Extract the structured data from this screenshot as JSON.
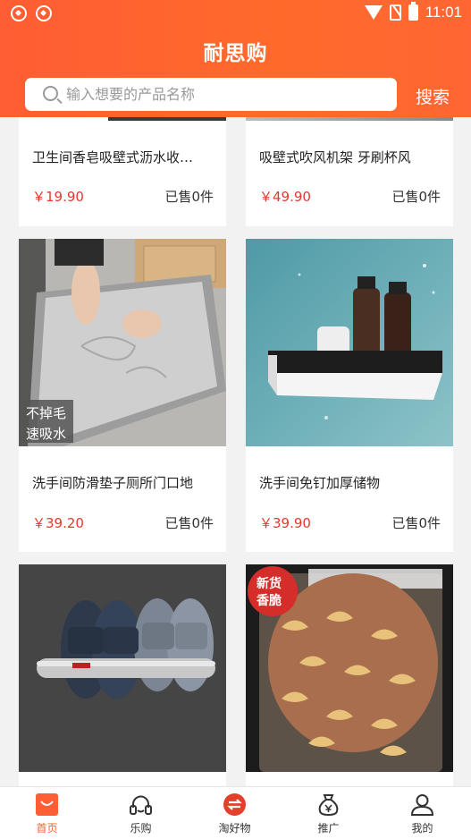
{
  "status_bar": {
    "time": "11:01"
  },
  "header": {
    "title": "耐思购"
  },
  "search": {
    "placeholder": "输入想要的产品名称",
    "button_label": "搜索"
  },
  "products": [
    {
      "name": "卫生间香皂吸壁式沥水收…",
      "price": "￥19.90",
      "sold": "已售0件"
    },
    {
      "name": "吸壁式吹风机架 牙刷杯风",
      "price": "￥49.90",
      "sold": "已售0件"
    },
    {
      "name": "洗手间防滑垫子厕所门口地",
      "price": "￥39.20",
      "sold": "已售0件",
      "image_badge": [
        "不掉毛",
        "速吸水"
      ]
    },
    {
      "name": "洗手间免钉加厚储物",
      "price": "￥39.90",
      "sold": "已售0件"
    },
    {
      "name": "",
      "price": "",
      "sold": ""
    },
    {
      "name": "",
      "price": "",
      "sold": "",
      "image_badge": [
        "新货",
        "香脆"
      ]
    }
  ],
  "tabbar": [
    {
      "label": "首页",
      "icon": "shopping-bag-icon",
      "active": true
    },
    {
      "label": "乐购",
      "icon": "headset-icon",
      "active": false
    },
    {
      "label": "淘好物",
      "icon": "exchange-icon",
      "active": false
    },
    {
      "label": "推广",
      "icon": "money-bag-icon",
      "active": false
    },
    {
      "label": "我的",
      "icon": "user-icon",
      "active": false
    }
  ],
  "colors": {
    "accent": "#ff5d33",
    "price": "#e8372c",
    "background": "#f2f2f2"
  }
}
